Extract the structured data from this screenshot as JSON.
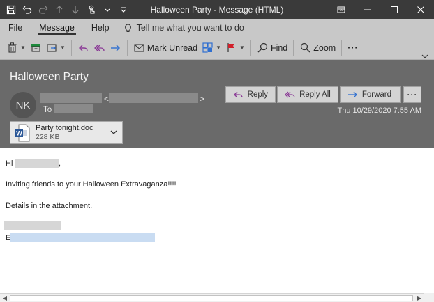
{
  "window": {
    "title": "Halloween Party  -  Message (HTML)"
  },
  "menu": {
    "items": [
      "File",
      "Message",
      "Help"
    ],
    "active": "Message",
    "tell_me": "Tell me what you want to do"
  },
  "ribbon": {
    "mark_unread": "Mark Unread",
    "find": "Find",
    "zoom": "Zoom",
    "more": "···"
  },
  "message": {
    "subject": "Halloween Party",
    "avatar_initials": "NK",
    "to_label": "To",
    "date": "Thu 10/29/2020 7:55 AM",
    "reply": "Reply",
    "reply_all": "Reply All",
    "forward": "Forward",
    "more": "···"
  },
  "attachment": {
    "name": "Party tonight.doc",
    "size": "228 KB"
  },
  "body": {
    "greeting": "Hi",
    "greeting_suffix": ",",
    "line1": "Inviting friends to your Halloween Extravaganza!!!!",
    "line2": "Details in the attachment.",
    "signature_prefix": "E"
  },
  "colors": {
    "titlebar": "#3a3a3a",
    "ribbon": "#c8c8c8",
    "header": "#6a6a6a",
    "reply_icon": "#8a3a96",
    "forward_icon": "#2f6fd0",
    "word_blue": "#2b5797"
  },
  "icons": [
    "save-icon",
    "undo-icon",
    "redo-icon",
    "arrow-up-icon",
    "arrow-down-icon",
    "touch-icon",
    "lightbulb-icon",
    "delete-icon",
    "archive-icon",
    "move-icon",
    "reply-icon",
    "reply-all-icon",
    "forward-icon",
    "mail-unread-icon",
    "categorize-icon",
    "flag-icon",
    "search-icon",
    "zoom-icon",
    "word-document-icon"
  ]
}
